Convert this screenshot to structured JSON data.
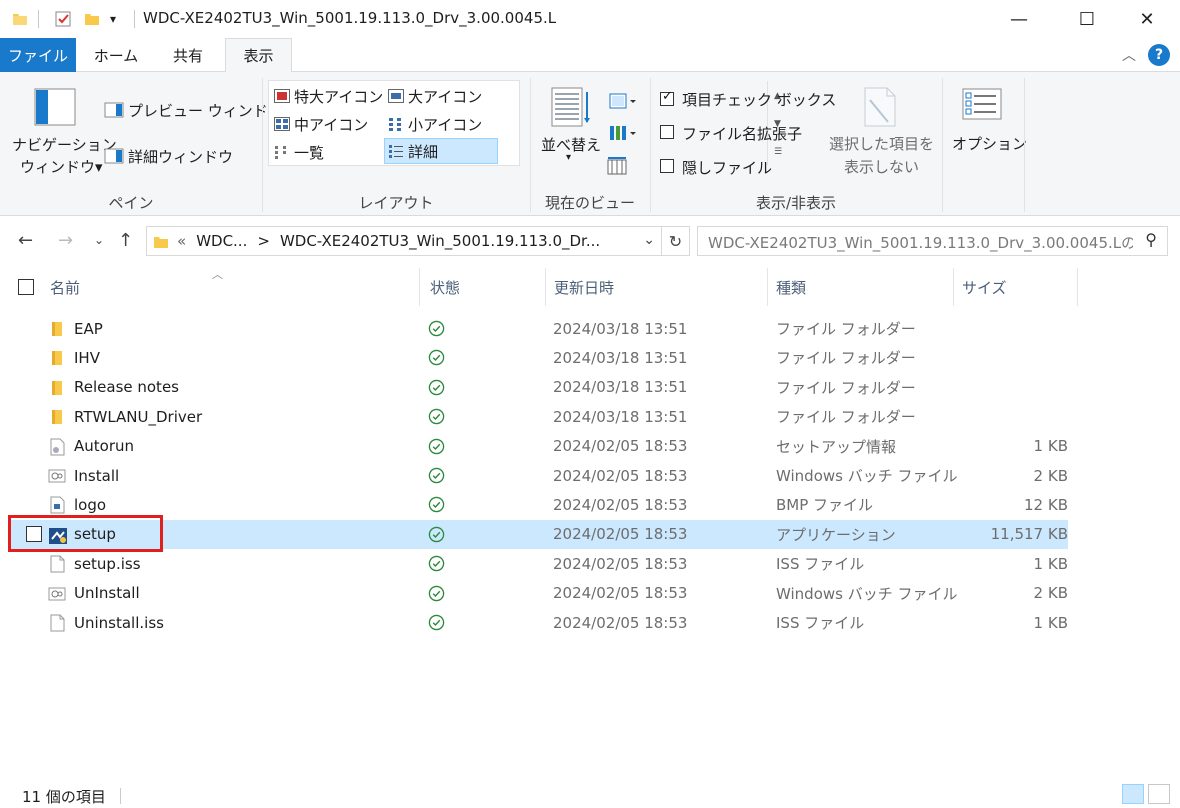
{
  "window": {
    "title": "WDC-XE2402TU3_Win_5001.19.113.0_Drv_3.00.0045.L",
    "minimize": "—",
    "maximize": "☐",
    "close": "✕"
  },
  "tabs": [
    "ファイル",
    "ホーム",
    "共有",
    "表示"
  ],
  "ribbon": {
    "pane": {
      "nav_pane_line1": "ナビゲーション",
      "nav_pane_line2": "ウィンドウ▾",
      "preview": "プレビュー ウィンドウ",
      "details": "詳細ウィンドウ",
      "label": "ペイン"
    },
    "layout": {
      "items": [
        "特大アイコン",
        "大アイコン",
        "中アイコン",
        "小アイコン",
        "一覧",
        "詳細"
      ],
      "label": "レイアウト"
    },
    "current_view": {
      "sort": "並べ替え",
      "label": "現在のビュー"
    },
    "show_hide": {
      "item_checkbox": "項目チェック ボックス",
      "extensions": "ファイル名拡張子",
      "hidden": "隠しファイル",
      "hide_selected_line1": "選択した項目を",
      "hide_selected_line2": "表示しない",
      "label": "表示/非表示"
    },
    "options": "オプション"
  },
  "address": {
    "crumb_root": "«",
    "crumb1": "WDC...",
    "sep": ">",
    "crumb2": "WDC-XE2402TU3_Win_5001.19.113.0_Dr...",
    "search_placeholder": "WDC-XE2402TU3_Win_5001.19.113.0_Drv_3.00.0045.Lの..."
  },
  "columns": {
    "name": "名前",
    "status": "状態",
    "date": "更新日時",
    "type": "種類",
    "size": "サイズ"
  },
  "files": [
    {
      "name": "EAP",
      "date": "2024/03/18 13:51",
      "type": "ファイル フォルダー",
      "size": "",
      "icon": "folder-icon"
    },
    {
      "name": "IHV",
      "date": "2024/03/18 13:51",
      "type": "ファイル フォルダー",
      "size": "",
      "icon": "folder-icon"
    },
    {
      "name": "Release notes",
      "date": "2024/03/18 13:51",
      "type": "ファイル フォルダー",
      "size": "",
      "icon": "folder-icon"
    },
    {
      "name": "RTWLANU_Driver",
      "date": "2024/03/18 13:51",
      "type": "ファイル フォルダー",
      "size": "",
      "icon": "folder-icon"
    },
    {
      "name": "Autorun",
      "date": "2024/02/05 18:53",
      "type": "セットアップ情報",
      "size": "1 KB",
      "icon": "setup-info-icon"
    },
    {
      "name": "Install",
      "date": "2024/02/05 18:53",
      "type": "Windows バッチ ファイル",
      "size": "2 KB",
      "icon": "batch-file-icon"
    },
    {
      "name": "logo",
      "date": "2024/02/05 18:53",
      "type": "BMP ファイル",
      "size": "12 KB",
      "icon": "bmp-file-icon"
    },
    {
      "name": "setup",
      "date": "2024/02/05 18:53",
      "type": "アプリケーション",
      "size": "11,517 KB",
      "icon": "application-icon"
    },
    {
      "name": "setup.iss",
      "date": "2024/02/05 18:53",
      "type": "ISS ファイル",
      "size": "1 KB",
      "icon": "file-icon"
    },
    {
      "name": "UnInstall",
      "date": "2024/02/05 18:53",
      "type": "Windows バッチ ファイル",
      "size": "2 KB",
      "icon": "batch-file-icon"
    },
    {
      "name": "Uninstall.iss",
      "date": "2024/02/05 18:53",
      "type": "ISS ファイル",
      "size": "1 KB",
      "icon": "file-icon"
    }
  ],
  "status": {
    "count": "11 個の項目"
  },
  "colors": {
    "accent": "#1979ca",
    "selection": "#cce8ff",
    "highlight": "#e0201f",
    "sync_ok": "#2a8a3a",
    "folder": "#f8c94a"
  }
}
